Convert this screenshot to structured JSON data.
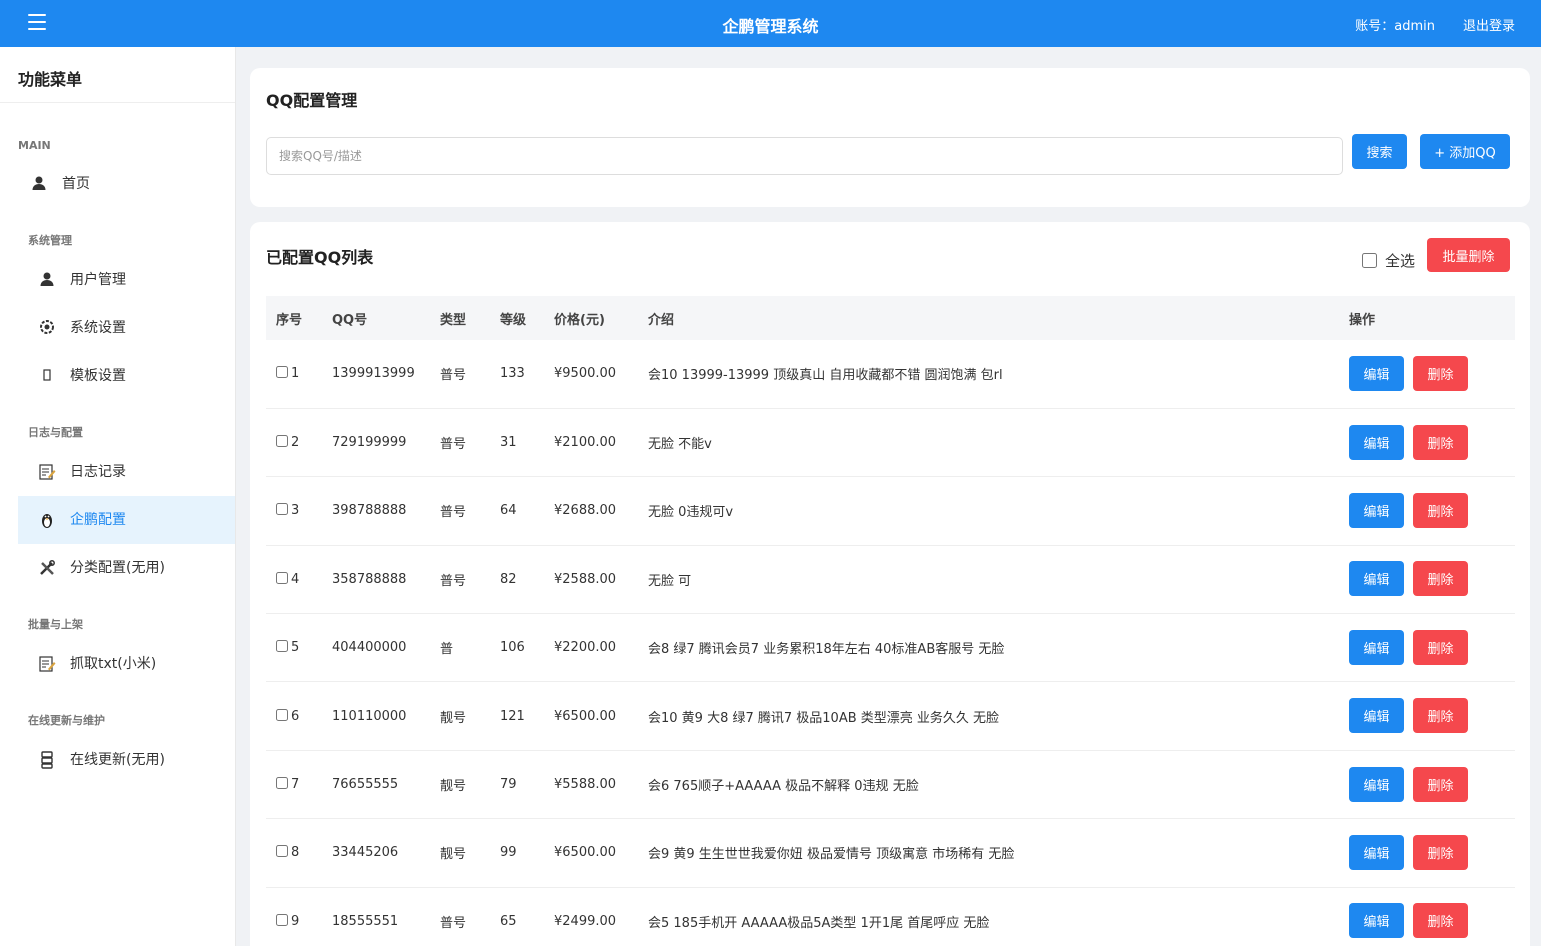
{
  "header": {
    "title": "企鹏管理系统",
    "account": "账号：admin",
    "logout": "退出登录",
    "color": "#1e88f0"
  },
  "sidebar": {
    "title": "功能菜单",
    "sections": [
      {
        "label": "MAIN",
        "items": [
          {
            "label": "首页",
            "icon": "user-icon"
          }
        ]
      },
      {
        "label": "系统管理",
        "items": [
          {
            "label": "用户管理",
            "icon": "user-icon"
          },
          {
            "label": "系统设置",
            "icon": "gear-icon"
          },
          {
            "label": "模板设置",
            "icon": "template-icon"
          }
        ]
      },
      {
        "label": "日志与配置",
        "items": [
          {
            "label": "日志记录",
            "icon": "edit-note-icon"
          },
          {
            "label": "企鹏配置",
            "icon": "penguin-icon",
            "active": true
          },
          {
            "label": "分类配置(无用)",
            "icon": "tools-icon"
          }
        ]
      },
      {
        "label": "批量与上架",
        "items": [
          {
            "label": "抓取txt(小米)",
            "icon": "edit-note-icon"
          }
        ]
      },
      {
        "label": "在线更新与维护",
        "items": [
          {
            "label": "在线更新(无用)",
            "icon": "server-icon"
          }
        ]
      }
    ]
  },
  "config": {
    "title": "QQ配置管理",
    "search_placeholder": "搜索QQ号/描述",
    "search_label": "搜索",
    "add_label": "+ 添加QQ"
  },
  "list": {
    "title": "已配置QQ列表",
    "select_all": "全选",
    "batch_delete": "批量删除",
    "columns": [
      "序号",
      "QQ号",
      "类型",
      "等级",
      "价格(元)",
      "介绍",
      "操作"
    ],
    "edit_label": "编辑",
    "delete_label": "删除",
    "rows": [
      {
        "idx": "1",
        "qq": "1399913999",
        "type": "普号",
        "level": "133",
        "price": "¥9500.00",
        "intro": "会10 13999-13999 顶级真山 自用收藏都不错 圆润饱满 包rl"
      },
      {
        "idx": "2",
        "qq": "729199999",
        "type": "普号",
        "level": "31",
        "price": "¥2100.00",
        "intro": "无脸 不能v"
      },
      {
        "idx": "3",
        "qq": "398788888",
        "type": "普号",
        "level": "64",
        "price": "¥2688.00",
        "intro": "无脸 0违规可v"
      },
      {
        "idx": "4",
        "qq": "358788888",
        "type": "普号",
        "level": "82",
        "price": "¥2588.00",
        "intro": "无脸 可"
      },
      {
        "idx": "5",
        "qq": "404400000",
        "type": "普",
        "level": "106",
        "price": "¥2200.00",
        "intro": "会8 绿7 腾讯会员7 业务累积18年左右 40标准AB客服号 无脸"
      },
      {
        "idx": "6",
        "qq": "110110000",
        "type": "靓号",
        "level": "121",
        "price": "¥6500.00",
        "intro": "会10 黄9 大8 绿7 腾讯7 极品10AB 类型漂亮 业务久久 无脸"
      },
      {
        "idx": "7",
        "qq": "76655555",
        "type": "靓号",
        "level": "79",
        "price": "¥5588.00",
        "intro": "会6 765顺子+AAAAA 极品不解释 0违规 无脸"
      },
      {
        "idx": "8",
        "qq": "33445206",
        "type": "靓号",
        "level": "99",
        "price": "¥6500.00",
        "intro": "会9 黄9 生生世世我爱你妞 极品爱情号 顶级寓意 市场稀有 无脸"
      },
      {
        "idx": "9",
        "qq": "18555551",
        "type": "普号",
        "level": "65",
        "price": "¥2499.00",
        "intro": "会5 185手机开 AAAAA极品5A类型 1开1尾 首尾呼应 无脸"
      }
    ]
  }
}
